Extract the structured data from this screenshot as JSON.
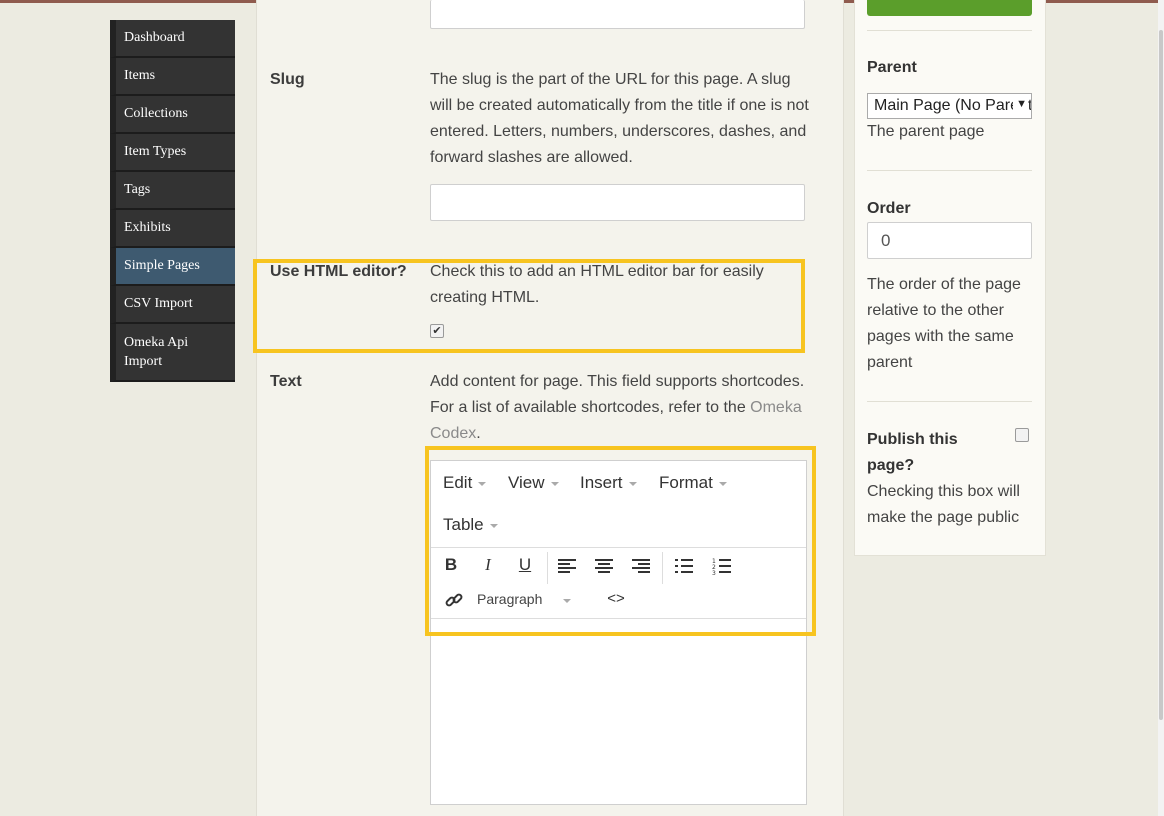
{
  "nav": {
    "items": [
      {
        "label": "Dashboard"
      },
      {
        "label": "Items"
      },
      {
        "label": "Collections"
      },
      {
        "label": "Item Types"
      },
      {
        "label": "Tags"
      },
      {
        "label": "Exhibits"
      },
      {
        "label": "Simple Pages"
      },
      {
        "label": "CSV Import"
      },
      {
        "label": "Omeka Api Import"
      }
    ],
    "active": "Simple Pages"
  },
  "form": {
    "slug": {
      "label": "Slug",
      "help": "The slug is the part of the URL for this page. A slug will be created automatically from the title if one is not entered. Letters, numbers, underscores, dashes, and forward slashes are allowed.",
      "value": ""
    },
    "html_editor": {
      "label": "Use HTML editor?",
      "help": "Check this to add an HTML editor bar for easily creating HTML.",
      "checked": true,
      "check_glyph": "✔"
    },
    "text": {
      "label": "Text",
      "help_prefix": "Add content for page. This field supports shortcodes. For a list of available shortcodes, refer to the ",
      "help_link": "Omeka Codex",
      "help_suffix": "."
    }
  },
  "editor": {
    "menus": [
      "Edit",
      "View",
      "Insert",
      "Format",
      "Table"
    ],
    "toolbar": {
      "bold": "B",
      "italic": "I",
      "underline": "U",
      "block_format": "Paragraph",
      "code": "<>"
    }
  },
  "sidebar": {
    "parent": {
      "label": "Parent",
      "selected": "Main Page (No Parent)",
      "help": "The parent page"
    },
    "order": {
      "label": "Order",
      "value": "0",
      "help": "The order of the page relative to the other pages with the same parent"
    },
    "publish": {
      "label": "Publish this page?",
      "checked": false,
      "help": "Checking this box will make the page public"
    }
  },
  "colors": {
    "highlight": "#f7c420",
    "nav_bg": "#333333",
    "nav_active": "#3e5a70",
    "publish_green": "#5b9e2b"
  }
}
